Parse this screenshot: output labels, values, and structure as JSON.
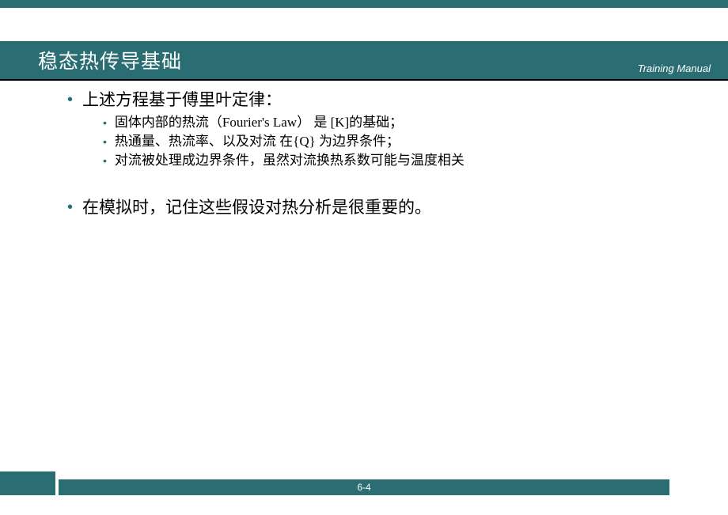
{
  "header": {
    "title": "稳态热传导基础",
    "subtitle": "Training Manual"
  },
  "content": {
    "bullets": [
      {
        "text": "上述方程基于傅里叶定律：",
        "sub": [
          " 固体内部的热流（Fourier's Law） 是 [K]的基础；",
          "热通量、热流率、以及对流  在{Q}  为边界条件；",
          "对流被处理成边界条件，虽然对流换热系数可能与温度相关"
        ]
      },
      {
        "text": "在模拟时，记住这些假设对热分析是很重要的。",
        "sub": []
      }
    ]
  },
  "footer": {
    "page": "6-4"
  }
}
